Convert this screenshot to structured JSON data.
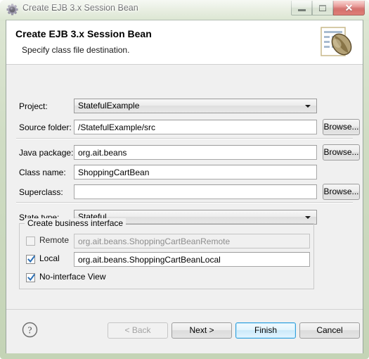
{
  "window": {
    "title": "Create EJB 3.x Session Bean",
    "icon": "ejb-wizard-gear-icon",
    "controls": {
      "minimize": "minimize-button",
      "maximize": "maximize-button",
      "close": "close-button",
      "close_glyph": "✕"
    }
  },
  "header": {
    "title": "Create EJB 3.x Session Bean",
    "subtitle": "Specify class file destination.",
    "icon": "java-bean-class-file-icon"
  },
  "form": {
    "project": {
      "label": "Project:",
      "value": "StatefulExample",
      "type": "combobox"
    },
    "source_folder": {
      "label": "Source folder:",
      "value": "/StatefulExample/src",
      "browse_label": "Browse..."
    },
    "java_package": {
      "label": "Java package:",
      "value": "org.ait.beans",
      "browse_label": "Browse..."
    },
    "class_name": {
      "label": "Class name:",
      "value": "ShoppingCartBean"
    },
    "superclass": {
      "label": "Superclass:",
      "value": "",
      "browse_label": "Browse..."
    },
    "state_type": {
      "label": "State type:",
      "value": "Stateful",
      "type": "combobox"
    },
    "business_interface": {
      "legend": "Create business interface",
      "remote": {
        "label": "Remote",
        "checked": false,
        "value": "org.ait.beans.ShoppingCartBeanRemote",
        "enabled": false
      },
      "local": {
        "label": "Local",
        "checked": true,
        "value": "org.ait.beans.ShoppingCartBeanLocal",
        "enabled": true
      },
      "no_interface_view": {
        "label": "No-interface View",
        "checked": true
      }
    }
  },
  "buttonbar": {
    "help": "help-icon",
    "back": {
      "label": "< Back",
      "enabled": false
    },
    "next": {
      "label": "Next >",
      "enabled": true
    },
    "finish": {
      "label": "Finish",
      "enabled": true,
      "default": true
    },
    "cancel": {
      "label": "Cancel",
      "enabled": true
    }
  },
  "colors": {
    "frame": "#cfdcc3",
    "close_button": "#d2403a",
    "dialog_bg": "#f0f0f0",
    "header_bg": "#ffffff",
    "default_button_focus": "#2f9fdd",
    "disabled_text": "#a3a3a3"
  }
}
